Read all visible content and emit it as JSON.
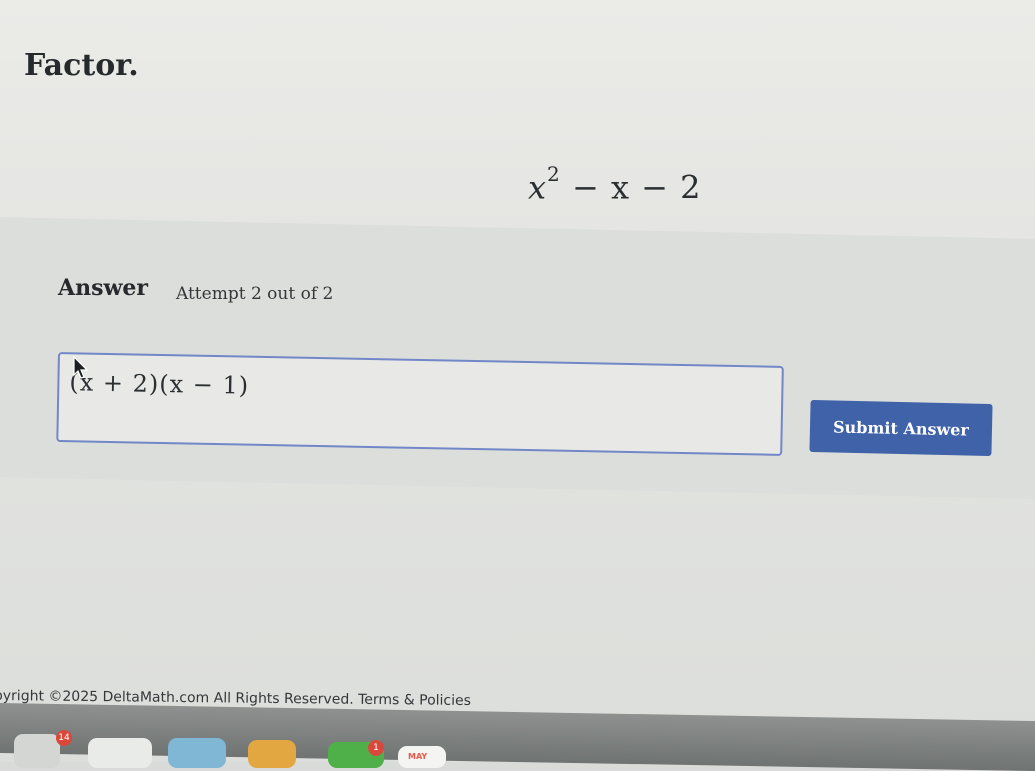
{
  "question": {
    "title": "Factor.",
    "expression": {
      "var": "x",
      "exponent": "2",
      "rest": " − x − 2"
    }
  },
  "answer": {
    "heading": "Answer",
    "attempt": "Attempt 2 out of 2",
    "value": "(x + 2)(x − 1)",
    "submit_label": "Submit Answer"
  },
  "footer": {
    "copyright": "pyright ©2025 DeltaMath.com All Rights Reserved. Terms & Policies"
  },
  "dock": {
    "badge_left": "14",
    "badge_right": "1",
    "calendar_month": "MAY"
  },
  "colors": {
    "submit": "#3f62a8",
    "input_border": "#7187c8"
  }
}
